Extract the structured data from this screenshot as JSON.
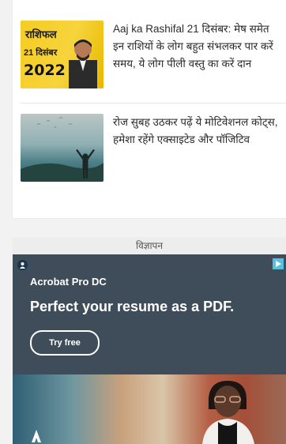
{
  "news": {
    "items": [
      {
        "thumb": {
          "title": "राशिफल",
          "date": "21 दिसंबर",
          "year": "2022"
        },
        "headline": "Aaj ka Rashifal 21 दिसंबर: मेष समेत इन राशियों के लोग बहुत संभलकर पार करें समय, ये लोग पीली वस्तु का करें दान"
      },
      {
        "headline": "रोज सुबह उठकर पढ़ें ये मोटिवेशनल कोट्स, हमेशा रहेंगे एक्साइटेड और पॉजिटिव"
      }
    ]
  },
  "ad": {
    "label": "विज्ञापन",
    "brand": "Acrobat Pro DC",
    "tagline": "Perfect your resume as a PDF.",
    "cta": "Try free",
    "icons": [
      "adobe-logo-icon",
      "adchoices-icon"
    ],
    "colors": {
      "background": "#3f4d5b",
      "text": "#ffffff"
    }
  }
}
